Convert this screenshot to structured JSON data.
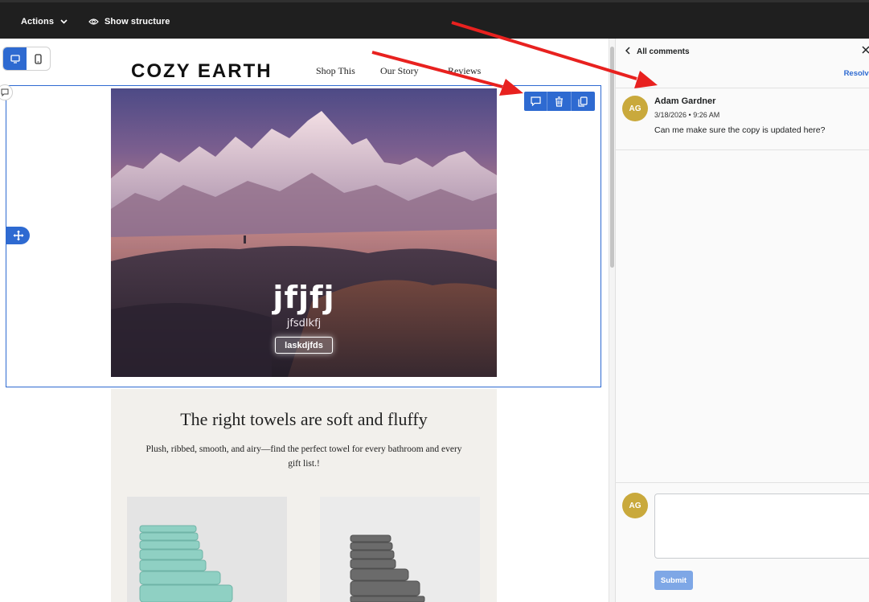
{
  "topbar": {
    "actions_label": "Actions",
    "structure_label": "Show structure"
  },
  "editor": {
    "brand": "COZY EARTH",
    "nav": [
      "Shop This",
      "Our Story",
      "Reviews"
    ],
    "hero": {
      "title": "jfjfj",
      "subtitle": "jfsdlkfj",
      "button": "laskdjfds"
    },
    "section": {
      "heading": "The right towels are soft and fluffy",
      "body": "Plush, ribbed, smooth, and airy—find the perfect towel for every bathroom and every gift list.!"
    },
    "user_initials": "AG"
  },
  "comments_panel": {
    "back_label": "All comments",
    "close_icon": "close-icon",
    "resolve_label": "Resolve",
    "comment": {
      "initials": "AG",
      "author": "Adam Gardner",
      "timestamp": "3/18/2026 • 9:26 AM",
      "text": "Can me make sure the copy is updated here?"
    },
    "composer": {
      "initials": "AG",
      "value": "",
      "submit_label": "Submit"
    }
  },
  "colors": {
    "accent": "#2e6ad1",
    "annotation_arrow": "#e8211f",
    "avatar": "#c9a93c",
    "user_avatar": "#e2477a"
  }
}
